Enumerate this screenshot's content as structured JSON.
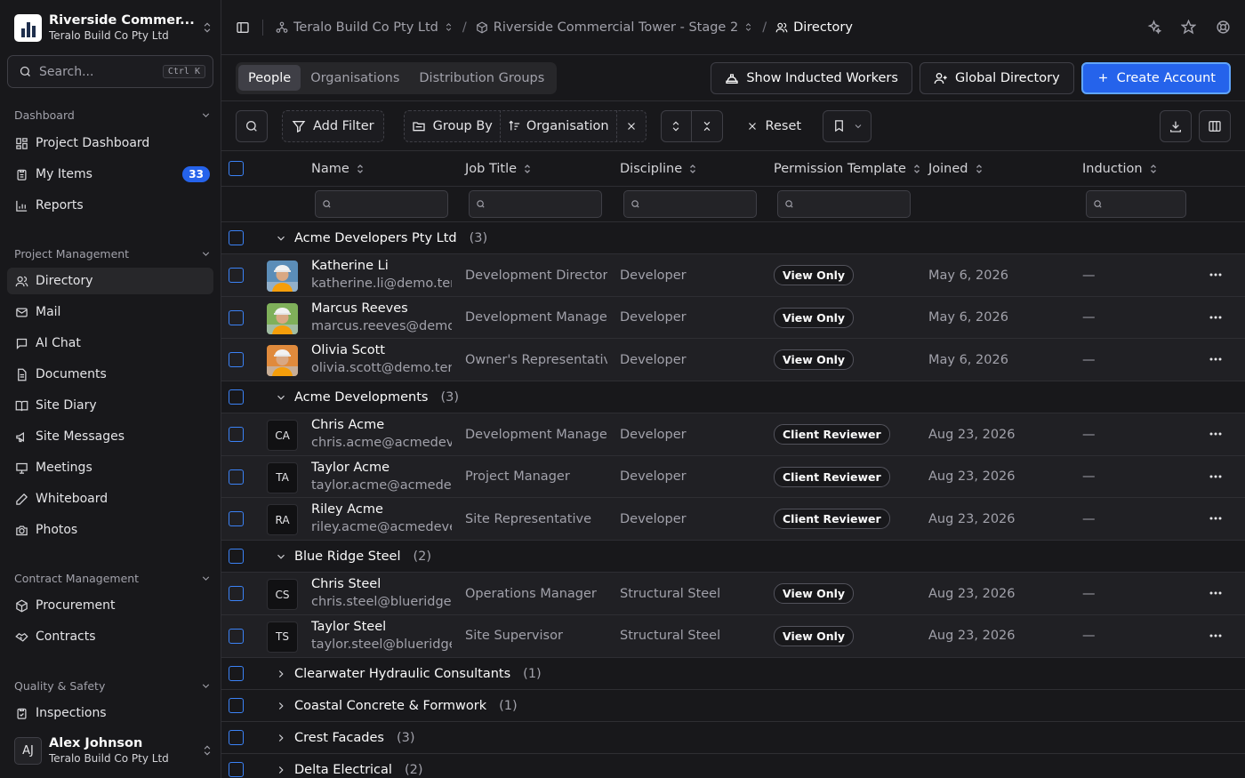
{
  "sidebar": {
    "project_name": "Riverside Commer...",
    "project_org": "Teralo Build Co Pty Ltd",
    "search_placeholder": "Search...",
    "search_shortcut": "Ctrl K",
    "sections": {
      "dashboard": "Dashboard",
      "project_management": "Project Management",
      "contract_management": "Contract Management",
      "quality_safety": "Quality & Safety"
    },
    "items": {
      "project_dashboard": "Project Dashboard",
      "my_items": "My Items",
      "my_items_badge": "33",
      "reports": "Reports",
      "directory": "Directory",
      "mail": "Mail",
      "ai_chat": "AI Chat",
      "documents": "Documents",
      "site_diary": "Site Diary",
      "site_messages": "Site Messages",
      "meetings": "Meetings",
      "whiteboard": "Whiteboard",
      "photos": "Photos",
      "procurement": "Procurement",
      "contracts": "Contracts",
      "inspections": "Inspections"
    },
    "user": {
      "initials": "AJ",
      "name": "Alex Johnson",
      "org": "Teralo Build Co Pty Ltd"
    }
  },
  "header": {
    "breadcrumb": [
      "Teralo Build Co Pty Ltd",
      "Riverside Commercial Tower - Stage 2",
      "Directory"
    ]
  },
  "tabs": [
    "People",
    "Organisations",
    "Distribution Groups"
  ],
  "actions": {
    "inducted": "Show Inducted Workers",
    "global": "Global Directory",
    "create": "Create Account"
  },
  "toolbar": {
    "add_filter": "Add Filter",
    "group_by": "Group By",
    "group_value": "Organisation",
    "reset": "Reset"
  },
  "columns": [
    "Name",
    "Job Title",
    "Discipline",
    "Permission Template",
    "Joined",
    "Induction"
  ],
  "groups": [
    {
      "name": "Acme Developers Pty Ltd",
      "count": "(3)",
      "expanded": true,
      "people": [
        {
          "name": "Katherine Li",
          "email": "katherine.li@demo.teralo",
          "job": "Development Director",
          "discipline": "Developer",
          "template": "View Only",
          "joined": "May 6, 2026",
          "induction": "—",
          "avatar": "photo",
          "photo_color": "#5b8db8"
        },
        {
          "name": "Marcus Reeves",
          "email": "marcus.reeves@demo.teralo",
          "job": "Development Manager",
          "discipline": "Developer",
          "template": "View Only",
          "joined": "May 6, 2026",
          "induction": "—",
          "avatar": "photo",
          "photo_color": "#7fb05a"
        },
        {
          "name": "Olivia Scott",
          "email": "olivia.scott@demo.teralo",
          "job": "Owner's Representative",
          "discipline": "Developer",
          "template": "View Only",
          "joined": "May 6, 2026",
          "induction": "—",
          "avatar": "photo",
          "photo_color": "#e08a3c"
        }
      ]
    },
    {
      "name": "Acme Developments",
      "count": "(3)",
      "expanded": true,
      "people": [
        {
          "name": "Chris Acme",
          "email": "chris.acme@acmedevelopments",
          "job": "Development Manager",
          "discipline": "Developer",
          "template": "Client Reviewer",
          "joined": "Aug 23, 2026",
          "induction": "—",
          "avatar": "CA"
        },
        {
          "name": "Taylor Acme",
          "email": "taylor.acme@acmedevelopments",
          "job": "Project Manager",
          "discipline": "Developer",
          "template": "Client Reviewer",
          "joined": "Aug 23, 2026",
          "induction": "—",
          "avatar": "TA"
        },
        {
          "name": "Riley Acme",
          "email": "riley.acme@acmedevelopments",
          "job": "Site Representative",
          "discipline": "Developer",
          "template": "Client Reviewer",
          "joined": "Aug 23, 2026",
          "induction": "—",
          "avatar": "RA"
        }
      ]
    },
    {
      "name": "Blue Ridge Steel",
      "count": "(2)",
      "expanded": true,
      "people": [
        {
          "name": "Chris Steel",
          "email": "chris.steel@blueridgesteel",
          "job": "Operations Manager",
          "discipline": "Structural Steel",
          "template": "View Only",
          "joined": "Aug 23, 2026",
          "induction": "—",
          "avatar": "CS"
        },
        {
          "name": "Taylor Steel",
          "email": "taylor.steel@blueridgesteel",
          "job": "Site Supervisor",
          "discipline": "Structural Steel",
          "template": "View Only",
          "joined": "Aug 23, 2026",
          "induction": "—",
          "avatar": "TS"
        }
      ]
    },
    {
      "name": "Clearwater Hydraulic Consultants",
      "count": "(1)",
      "expanded": false,
      "people": []
    },
    {
      "name": "Coastal Concrete & Formwork",
      "count": "(1)",
      "expanded": false,
      "people": []
    },
    {
      "name": "Crest Facades",
      "count": "(3)",
      "expanded": false,
      "people": []
    },
    {
      "name": "Delta Electrical",
      "count": "(2)",
      "expanded": false,
      "people": []
    }
  ],
  "colors": {
    "accent": "#2563eb",
    "checkbox": "#3b82f6",
    "background": "#18181b"
  }
}
